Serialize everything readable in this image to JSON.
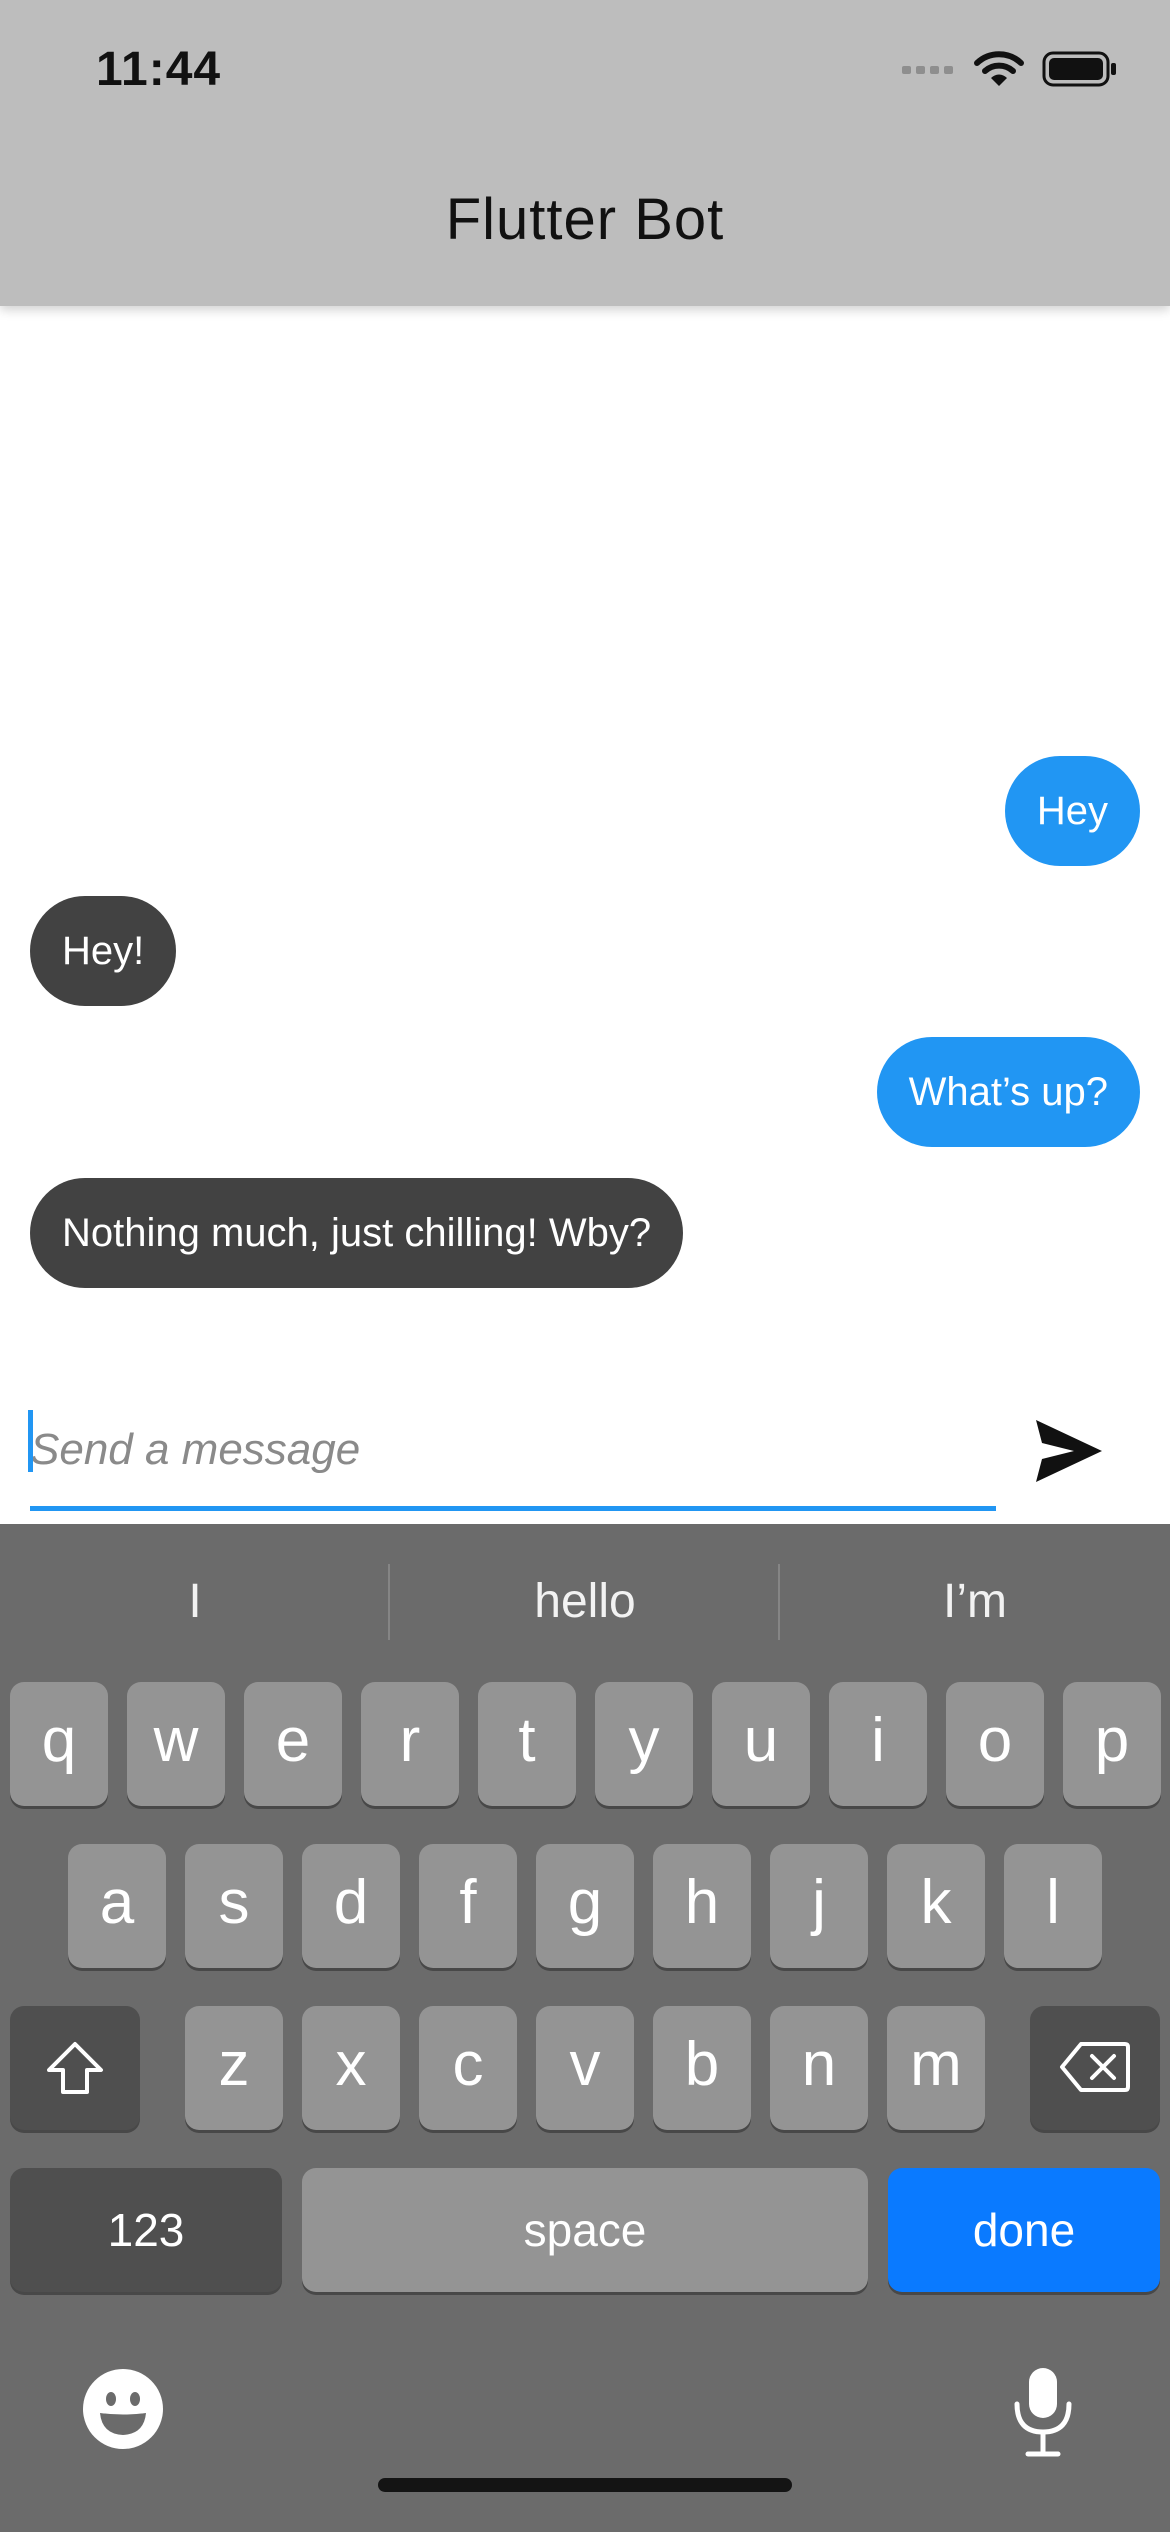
{
  "status_bar": {
    "time": "11:44"
  },
  "app_bar": {
    "title": "Flutter Bot"
  },
  "messages": [
    {
      "sender": "user",
      "text": "Hey"
    },
    {
      "sender": "bot",
      "text": "Hey!"
    },
    {
      "sender": "user",
      "text": "What’s up?"
    },
    {
      "sender": "bot",
      "text": "Nothing much, just chilling! Wby?"
    }
  ],
  "composer": {
    "placeholder": "Send a message",
    "value": ""
  },
  "keyboard": {
    "suggestions": [
      "I",
      "hello",
      "I’m"
    ],
    "row1": [
      "q",
      "w",
      "e",
      "r",
      "t",
      "y",
      "u",
      "i",
      "o",
      "p"
    ],
    "row2": [
      "a",
      "s",
      "d",
      "f",
      "g",
      "h",
      "j",
      "k",
      "l"
    ],
    "row3": [
      "z",
      "x",
      "c",
      "v",
      "b",
      "n",
      "m"
    ],
    "numbers_label": "123",
    "space_label": "space",
    "done_label": "done"
  },
  "colors": {
    "user_bubble": "#2196f3",
    "bot_bubble": "#424242",
    "app_bar": "#bdbdbd",
    "done_key": "#0a7aff",
    "keyboard_bg": "#6b6b6b"
  },
  "icons": {
    "signal": "cellular-signal-icon",
    "wifi": "wifi-icon",
    "battery": "battery-icon",
    "send": "send-icon",
    "shift": "shift-icon",
    "backspace": "backspace-icon",
    "emoji": "emoji-icon",
    "mic": "microphone-icon"
  }
}
